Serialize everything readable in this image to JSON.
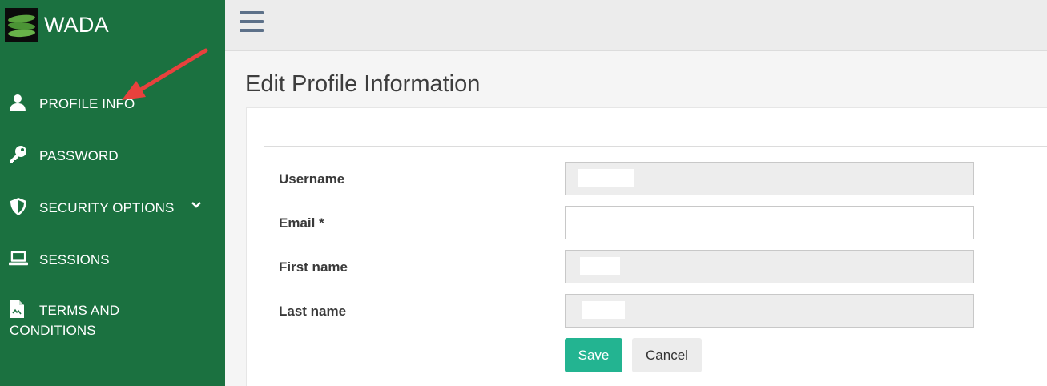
{
  "brand": {
    "name": "WADA",
    "logo_icon": "wada-leaf-logo"
  },
  "sidebar": {
    "items": [
      {
        "label": "PROFILE INFO",
        "icon": "user-icon"
      },
      {
        "label": "PASSWORD",
        "icon": "key-icon"
      },
      {
        "label": "SECURITY OPTIONS",
        "icon": "shield-icon",
        "has_submenu": true
      },
      {
        "label": "SESSIONS",
        "icon": "laptop-icon"
      },
      {
        "label": "TERMS AND",
        "label_line2": "CONDITIONS",
        "icon": "document-icon"
      }
    ]
  },
  "topbar": {
    "menu_icon": "hamburger-icon"
  },
  "page": {
    "title": "Edit Profile Information"
  },
  "form": {
    "fields": [
      {
        "label": "Username",
        "value": "",
        "readonly": true
      },
      {
        "label": "Email *",
        "value": "",
        "readonly": false
      },
      {
        "label": "First name",
        "value": "",
        "readonly": true
      },
      {
        "label": "Last name",
        "value": "",
        "readonly": true
      }
    ],
    "save_label": "Save",
    "cancel_label": "Cancel"
  },
  "colors": {
    "sidebar_bg": "#1b7140",
    "save_button": "#23b491",
    "annotation_arrow": "#e8413d"
  }
}
